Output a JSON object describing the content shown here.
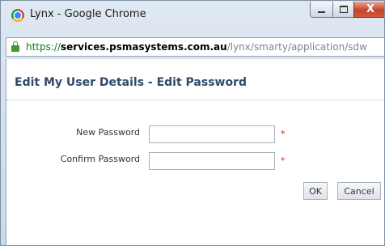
{
  "window": {
    "title": "Lynx - Google Chrome",
    "close_glyph": "X"
  },
  "address_bar": {
    "scheme": "https://",
    "host": "services.psmasystems.com.au",
    "path": "/lynx/smarty/application/sdw"
  },
  "page": {
    "title": "Edit My User Details - Edit Password"
  },
  "form": {
    "new_password_label": "New Password",
    "confirm_password_label": "Confirm Password",
    "new_password_value": "",
    "confirm_password_value": "",
    "required_marker": "*"
  },
  "buttons": {
    "ok": "OK",
    "cancel": "Cancel"
  },
  "colors": {
    "title_color": "#2e4a6b",
    "required_color": "#d9251d",
    "secure_url_color": "#0a7a22"
  }
}
